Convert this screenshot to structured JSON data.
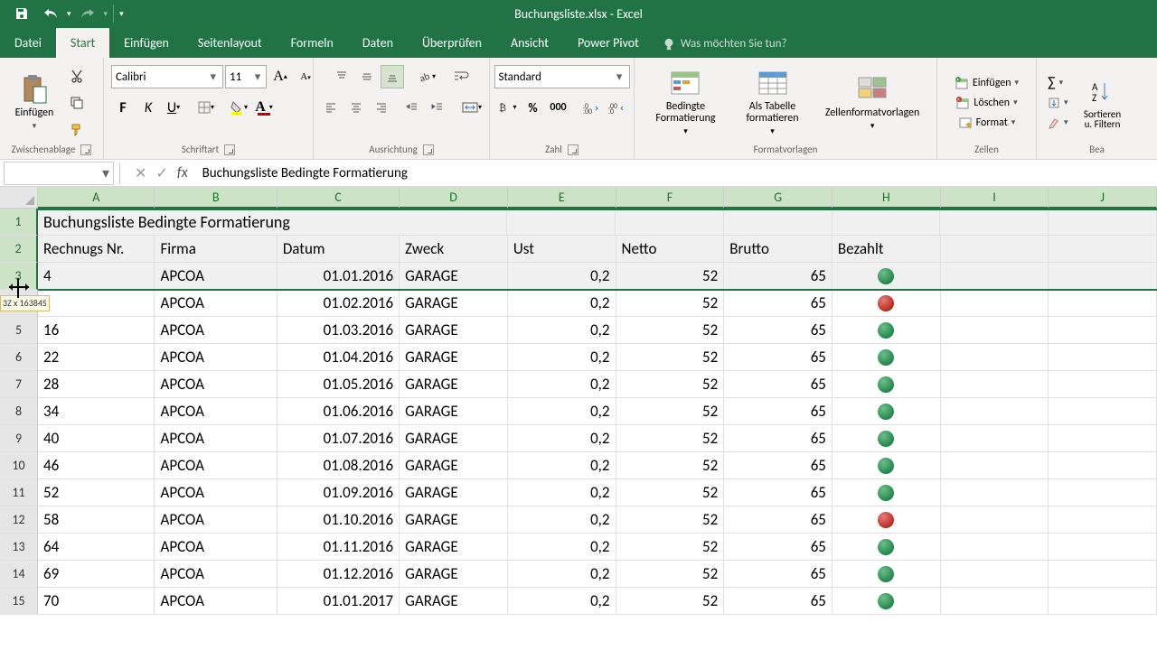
{
  "app": {
    "title": "Buchungsliste.xlsx - Excel"
  },
  "tabs": {
    "datei": "Datei",
    "start": "Start",
    "einfuegen": "Einfügen",
    "seitenlayout": "Seitenlayout",
    "formeln": "Formeln",
    "daten": "Daten",
    "ueberpruefen": "Überprüfen",
    "ansicht": "Ansicht",
    "powerpivot": "Power Pivot",
    "tell_me": "Was möchten Sie tun?"
  },
  "ribbon": {
    "clipboard": {
      "paste": "Einfügen",
      "group": "Zwischenablage"
    },
    "font": {
      "name": "Calibri",
      "size": "11",
      "group": "Schriftart"
    },
    "align": {
      "group": "Ausrichtung"
    },
    "number": {
      "format": "Standard",
      "group": "Zahl"
    },
    "styles": {
      "cond": "Bedingte Formatierung",
      "table": "Als Tabelle formatieren",
      "cellstyles": "Zellenformatvorlagen",
      "group": "Formatvorlagen"
    },
    "cells": {
      "insert": "Einfügen",
      "delete": "Löschen",
      "format": "Format",
      "group": "Zellen"
    },
    "editing": {
      "sort": "Sortieren u. Filtern",
      "group": "Bea"
    }
  },
  "fbar": {
    "name": "",
    "formula": "Buchungsliste Bedingte Formatierung"
  },
  "columns": [
    "A",
    "B",
    "C",
    "D",
    "E",
    "F",
    "G",
    "H",
    "I",
    "J"
  ],
  "rows": [
    "1",
    "2",
    "3",
    "4",
    "5",
    "6",
    "7",
    "8",
    "9",
    "10",
    "11",
    "12",
    "13",
    "14",
    "15"
  ],
  "selection_tip": "3Z x 16384S",
  "sheet": {
    "title": "Buchungsliste Bedingte Formatierung",
    "headers": {
      "a": "Rechnugs Nr.",
      "b": "Firma",
      "c": "Datum",
      "d": "Zweck",
      "e": "Ust",
      "f": "Netto",
      "g": "Brutto",
      "h": "Bezahlt"
    },
    "data": [
      {
        "nr": "4",
        "firma": "APCOA",
        "datum": "01.01.2016",
        "zweck": "GARAGE",
        "ust": "0,2",
        "netto": "52",
        "brutto": "65",
        "dot": "green"
      },
      {
        "nr": "",
        "firma": "APCOA",
        "datum": "01.02.2016",
        "zweck": "GARAGE",
        "ust": "0,2",
        "netto": "52",
        "brutto": "65",
        "dot": "red"
      },
      {
        "nr": "16",
        "firma": "APCOA",
        "datum": "01.03.2016",
        "zweck": "GARAGE",
        "ust": "0,2",
        "netto": "52",
        "brutto": "65",
        "dot": "green"
      },
      {
        "nr": "22",
        "firma": "APCOA",
        "datum": "01.04.2016",
        "zweck": "GARAGE",
        "ust": "0,2",
        "netto": "52",
        "brutto": "65",
        "dot": "green"
      },
      {
        "nr": "28",
        "firma": "APCOA",
        "datum": "01.05.2016",
        "zweck": "GARAGE",
        "ust": "0,2",
        "netto": "52",
        "brutto": "65",
        "dot": "green"
      },
      {
        "nr": "34",
        "firma": "APCOA",
        "datum": "01.06.2016",
        "zweck": "GARAGE",
        "ust": "0,2",
        "netto": "52",
        "brutto": "65",
        "dot": "green"
      },
      {
        "nr": "40",
        "firma": "APCOA",
        "datum": "01.07.2016",
        "zweck": "GARAGE",
        "ust": "0,2",
        "netto": "52",
        "brutto": "65",
        "dot": "green"
      },
      {
        "nr": "46",
        "firma": "APCOA",
        "datum": "01.08.2016",
        "zweck": "GARAGE",
        "ust": "0,2",
        "netto": "52",
        "brutto": "65",
        "dot": "green"
      },
      {
        "nr": "52",
        "firma": "APCOA",
        "datum": "01.09.2016",
        "zweck": "GARAGE",
        "ust": "0,2",
        "netto": "52",
        "brutto": "65",
        "dot": "green"
      },
      {
        "nr": "58",
        "firma": "APCOA",
        "datum": "01.10.2016",
        "zweck": "GARAGE",
        "ust": "0,2",
        "netto": "52",
        "brutto": "65",
        "dot": "red"
      },
      {
        "nr": "64",
        "firma": "APCOA",
        "datum": "01.11.2016",
        "zweck": "GARAGE",
        "ust": "0,2",
        "netto": "52",
        "brutto": "65",
        "dot": "green"
      },
      {
        "nr": "69",
        "firma": "APCOA",
        "datum": "01.12.2016",
        "zweck": "GARAGE",
        "ust": "0,2",
        "netto": "52",
        "brutto": "65",
        "dot": "green"
      },
      {
        "nr": "70",
        "firma": "APCOA",
        "datum": "01.01.2017",
        "zweck": "GARAGE",
        "ust": "0,2",
        "netto": "52",
        "brutto": "65",
        "dot": "green"
      }
    ]
  }
}
